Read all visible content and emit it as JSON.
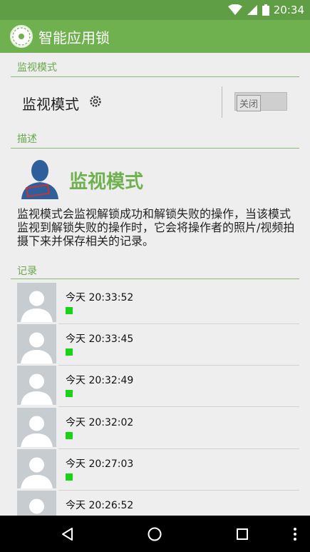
{
  "status_bar": {
    "time": "20:34"
  },
  "app_bar": {
    "title": "智能应用锁"
  },
  "monitor_section": {
    "header": "监视模式",
    "label": "监视模式",
    "toggle_label": "关闭"
  },
  "description_section": {
    "header": "描述",
    "title": "监视模式",
    "text": "监视模式会监视解锁成功和解锁失败的操作，当该模式监视到解锁失败的操作时，它会将操作者的照片/视频拍摄下来并保存相关的记录。"
  },
  "records_section": {
    "header": "记录",
    "items": [
      {
        "time": "今天 20:33:52"
      },
      {
        "time": "今天 20:33:45"
      },
      {
        "time": "今天 20:32:49"
      },
      {
        "time": "今天 20:32:02"
      },
      {
        "time": "今天 20:27:03"
      },
      {
        "time": "今天 20:26:52"
      }
    ]
  },
  "colors": {
    "accent": "#6fb14f",
    "status_bar": "#5f9e45",
    "success_dot": "#19d219"
  },
  "icons": [
    "wifi-icon",
    "signal-icon",
    "battery-icon",
    "gear-icon",
    "back-icon",
    "home-icon",
    "recents-icon",
    "overflow-icon"
  ]
}
